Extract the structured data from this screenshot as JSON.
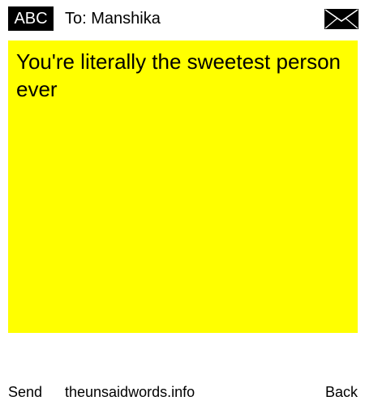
{
  "header": {
    "badge_label": "ABC",
    "to_label": "To: Manshika"
  },
  "note": {
    "message": "You're literally the sweetest person ever",
    "background_color": "#ffff00"
  },
  "footer": {
    "send_label": "Send",
    "site_label": "theunsaidwords.info",
    "back_label": "Back"
  },
  "icons": {
    "envelope": "envelope-icon"
  }
}
